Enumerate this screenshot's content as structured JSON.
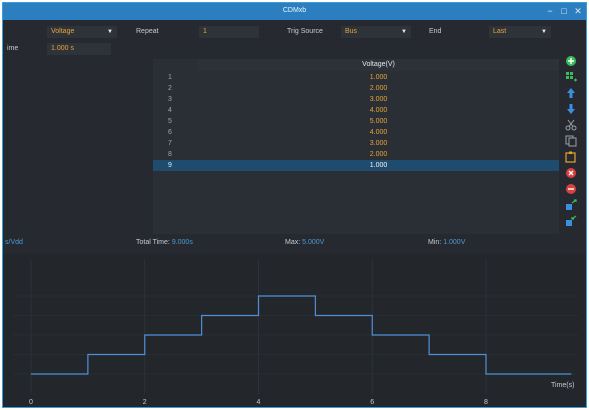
{
  "window": {
    "title": "CDMxb"
  },
  "controls": {
    "mode_value": "Voltage",
    "repeat_label": "Repeat",
    "repeat_value": "1",
    "trig_source_label": "Trig Source",
    "trig_source_value": "Bus",
    "end_label": "End",
    "end_value": "Last",
    "time_label": "ime",
    "time_value": "1.000 s"
  },
  "table": {
    "header": "Voltage(V)",
    "rows": [
      {
        "index": "1",
        "value": "1.000"
      },
      {
        "index": "2",
        "value": "2.000"
      },
      {
        "index": "3",
        "value": "3.000"
      },
      {
        "index": "4",
        "value": "4.000"
      },
      {
        "index": "5",
        "value": "5.000"
      },
      {
        "index": "6",
        "value": "4.000"
      },
      {
        "index": "7",
        "value": "3.000"
      },
      {
        "index": "8",
        "value": "2.000"
      },
      {
        "index": "9",
        "value": "1.000"
      }
    ],
    "selected_row": 9
  },
  "stats": {
    "left_value": "s/Vdd",
    "total_time_label": "Total Time:",
    "total_time_value": "9.000s",
    "max_label": "Max:",
    "max_value": "5.000V",
    "min_label": "Min:",
    "min_value": "1.000V"
  },
  "plot": {
    "x_axis_label": "Time(s)",
    "x_ticks": [
      "0",
      "2",
      "4",
      "6",
      "8"
    ],
    "line_color": "#4f8fd6"
  },
  "chart_data": {
    "type": "line",
    "x": [
      0,
      1,
      2,
      3,
      4,
      5,
      6,
      7,
      8,
      9
    ],
    "values": [
      1,
      2,
      3,
      4,
      5,
      4,
      3,
      2,
      1,
      1
    ],
    "step": true,
    "xlabel": "Time(s)",
    "xlim": [
      -0.2,
      9.5
    ],
    "ylim": [
      0,
      6
    ]
  },
  "side_icons": [
    {
      "name": "add-icon",
      "color": "#3dbb59"
    },
    {
      "name": "grid-add-icon",
      "color": "#3dbb59"
    },
    {
      "name": "move-up-icon",
      "color": "#3a8fe0"
    },
    {
      "name": "move-down-icon",
      "color": "#3a8fe0"
    },
    {
      "name": "cut-icon",
      "color": "#9aa0a8"
    },
    {
      "name": "copy-icon",
      "color": "#9aa0a8"
    },
    {
      "name": "paste-icon",
      "color": "#e6a22e"
    },
    {
      "name": "delete-icon",
      "color": "#d94040"
    },
    {
      "name": "remove-icon",
      "color": "#d94040"
    },
    {
      "name": "import-icon",
      "color": "#3a8fe0"
    },
    {
      "name": "export-icon",
      "color": "#3a8fe0"
    }
  ]
}
